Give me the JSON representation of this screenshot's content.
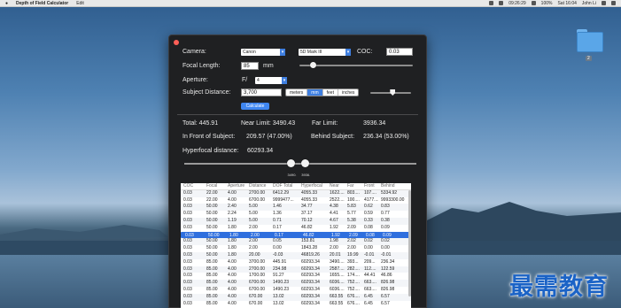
{
  "menubar": {
    "app_name": "Depth of Field Calculator",
    "edit": "Edit",
    "clock_a": "09:26:29",
    "battery": "100%",
    "datetime": "Sat 16:04",
    "user": "John Li"
  },
  "desktop": {
    "folder_badge": "2",
    "watermark": "最需教育"
  },
  "form": {
    "camera_label": "Camera:",
    "camera_brand": "Canon",
    "camera_model": "5D Mark III",
    "coc_label": "COC:",
    "coc_value": "0.03",
    "focal_label": "Focal Length:",
    "focal_value": "85",
    "focal_unit": "mm",
    "aperture_label": "Aperture:",
    "aperture_prefix": "F/",
    "aperture_value": "4",
    "distance_label": "Subject Distance:",
    "distance_value": "3,700",
    "units": [
      "meters",
      "mm",
      "feet",
      "inches"
    ],
    "unit_selected": 1,
    "calculate_label": "Calculate",
    "focal_slider_level": 0.12,
    "distance_slider_level": 0.55
  },
  "results": {
    "total": "Total:  445.91",
    "near": "Near Limit:  3490.43",
    "far": "Far Limit:",
    "far_value": "3936.34",
    "front": "In Front of Subject:",
    "front_value": "209.57 (47.00%)",
    "behind": "Behind Subject:",
    "behind_value": "236.34 (53.00%)",
    "hyperfocal": "Hyperfocal distance:",
    "hyperfocal_value": "60293.34",
    "near_marker": "3490.",
    "far_marker": "3936.",
    "near_marker_level": 0.46,
    "far_marker_level": 0.52
  },
  "table": {
    "headers": [
      "COC",
      "Focal",
      "Aperture",
      "Distance",
      "DOF Total",
      "Hyperfocal",
      "Near",
      "Far",
      "Front",
      "Behind"
    ],
    "selected_row": 6,
    "rows": [
      [
        "0.03",
        "22.00",
        "4.00",
        "2700.00",
        "6412.29",
        "4055.33",
        "1622....",
        "803....",
        "107....",
        "5334.92"
      ],
      [
        "0.03",
        "22.00",
        "4.00",
        "6700.00",
        "9999477...",
        "4055.33",
        "2522....",
        "100....",
        "4177....",
        "9993300.00"
      ],
      [
        "0.03",
        "50.00",
        "2.40",
        "5.00",
        "1.46",
        "34.77",
        "4.38",
        "5.83",
        "0.62",
        "0.83"
      ],
      [
        "0.03",
        "50.00",
        "2.24",
        "5.00",
        "1.36",
        "37.17",
        "4.41",
        "5.77",
        "0.59",
        "0.77"
      ],
      [
        "0.03",
        "50.00",
        "1.19",
        "5.00",
        "0.71",
        "70.12",
        "4.67",
        "5.38",
        "0.33",
        "0.38"
      ],
      [
        "0.03",
        "50.00",
        "1.80",
        "2.00",
        "0.17",
        "46.82",
        "1.92",
        "2.09",
        "0.08",
        "0.09"
      ],
      [
        "0.03",
        "50.00",
        "1.80",
        "2.00",
        "0.17",
        "46.82",
        "1.92",
        "2.09",
        "0.08",
        "0.09"
      ],
      [
        "0.03",
        "50.00",
        "1.80",
        "2.00",
        "0.17",
        "46.82",
        "1.92",
        "2.09",
        "0.08",
        "0.09"
      ],
      [
        "0.03",
        "50.00",
        "1.80",
        "2.00",
        "0.05",
        "153.81",
        "1.98",
        "2.02",
        "0.02",
        "0.02"
      ],
      [
        "0.03",
        "50.00",
        "1.80",
        "2.00",
        "0.00",
        "1843.28",
        "2.00",
        "2.00",
        "0.00",
        "0.00"
      ],
      [
        "0.03",
        "50.00",
        "1.80",
        "20.00",
        "-0.03",
        "46819.26",
        "20.01",
        "19.99",
        "-0.01",
        "-0.01"
      ],
      [
        "0.03",
        "85.00",
        "4.00",
        "3700.00",
        "445.91",
        "60293.34",
        "3490....",
        "393...",
        "209...",
        "236.34"
      ],
      [
        "0.03",
        "85.00",
        "4.00",
        "2700.00",
        "234.98",
        "60293.34",
        "2587....",
        "282....",
        "112....",
        "122.59"
      ],
      [
        "0.03",
        "85.00",
        "4.00",
        "1700.00",
        "91.27",
        "60293.34",
        "1655....",
        "174....",
        "44.41",
        "46.86"
      ],
      [
        "0.03",
        "85.00",
        "4.00",
        "6700.00",
        "1490.23",
        "60293.34",
        "6036....",
        "752....",
        "663....",
        "826.98"
      ],
      [
        "0.03",
        "85.00",
        "4.00",
        "6700.00",
        "1490.23",
        "60293.34",
        "6036....",
        "752....",
        "663....",
        "826.98"
      ],
      [
        "0.03",
        "85.00",
        "4.00",
        "670.00",
        "13.02",
        "60293.34",
        "663.55",
        "676....",
        "6.45",
        "6.57"
      ],
      [
        "0.03",
        "85.00",
        "4.00",
        "670.00",
        "13.02",
        "60293.34",
        "663.55",
        "676....",
        "6.45",
        "6.57"
      ]
    ]
  }
}
